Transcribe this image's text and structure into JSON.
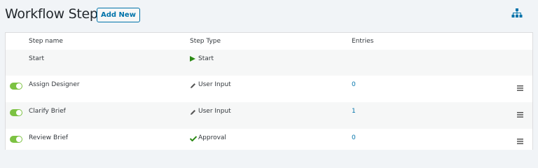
{
  "header": {
    "title": "Workflow Steps",
    "add_new_label": "Add New"
  },
  "columns": [
    "Step name",
    "Step Type",
    "Entries"
  ],
  "rows": [
    {
      "name": "Start",
      "type": "Start",
      "type_icon": "play-icon",
      "entries": "",
      "toggle": false
    },
    {
      "name": "Assign Designer",
      "type": "User Input",
      "type_icon": "pencil-icon",
      "entries": "0",
      "toggle": true
    },
    {
      "name": "Clarify Brief",
      "type": "User Input",
      "type_icon": "pencil-icon",
      "entries": "1",
      "toggle": true
    },
    {
      "name": "Review Brief",
      "type": "Approval",
      "type_icon": "checkmark-icon",
      "entries": "0",
      "toggle": true
    }
  ],
  "colors": {
    "accent": "#0073aa",
    "toggle_on": "#7cc242",
    "play": "#2b8a15",
    "check": "#2b8a15"
  }
}
